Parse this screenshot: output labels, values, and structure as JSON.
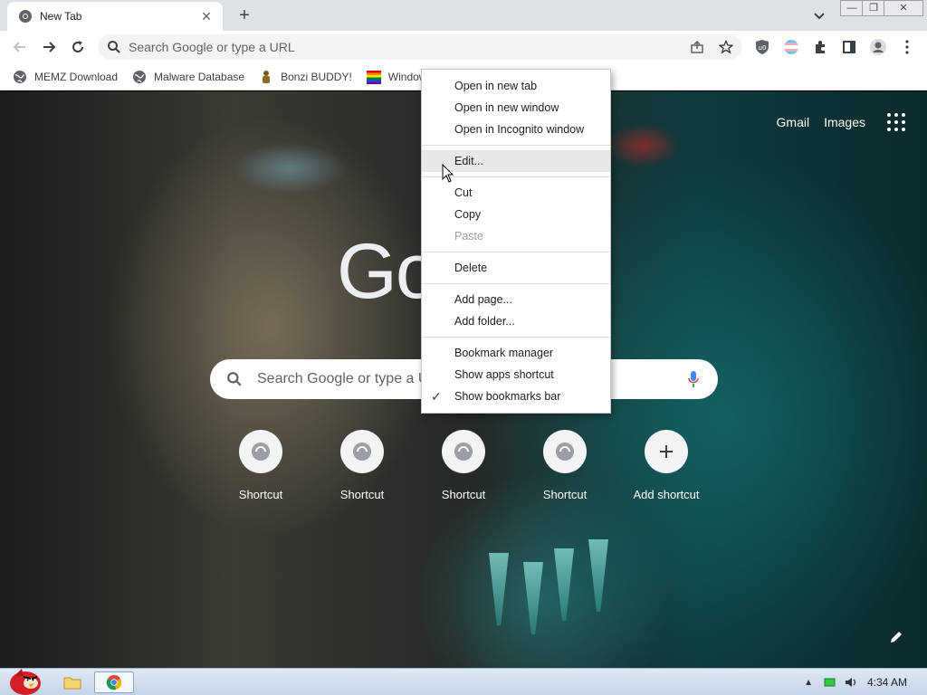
{
  "browser": {
    "tab": {
      "title": "New Tab"
    },
    "window_controls": [
      "minimize",
      "restore",
      "close"
    ]
  },
  "toolbar": {
    "omnibox_placeholder": "Search Google or type a URL"
  },
  "bookmarks": [
    {
      "label": "MEMZ Download",
      "icon": "globe-icon"
    },
    {
      "label": "Malware Database",
      "icon": "globe-icon"
    },
    {
      "label": "Bonzi BUDDY!",
      "icon": "bonzi-icon"
    },
    {
      "label": "Window",
      "icon": "windows-flag-icon"
    }
  ],
  "ntp": {
    "top_links": {
      "gmail": "Gmail",
      "images": "Images"
    },
    "logo_text": "Go",
    "search_placeholder": "Search Google or type a URL",
    "shortcuts": [
      {
        "label": "Shortcut",
        "icon": "shortcut-icon"
      },
      {
        "label": "Shortcut",
        "icon": "shortcut-icon"
      },
      {
        "label": "Shortcut",
        "icon": "shortcut-icon"
      },
      {
        "label": "Shortcut",
        "icon": "shortcut-icon"
      },
      {
        "label": "Add shortcut",
        "icon": "plus-icon"
      }
    ]
  },
  "context_menu": {
    "groups": [
      [
        "Open in new tab",
        "Open in new window",
        "Open in Incognito window"
      ],
      [
        "Edit..."
      ],
      [
        "Cut",
        "Copy",
        "Paste"
      ],
      [
        "Delete"
      ],
      [
        "Add page...",
        "Add folder..."
      ],
      [
        "Bookmark manager",
        "Show apps shortcut",
        "Show bookmarks bar"
      ]
    ],
    "items": {
      "open_new_tab": "Open in new tab",
      "open_new_window": "Open in new window",
      "open_incognito": "Open in Incognito window",
      "edit": "Edit...",
      "cut": "Cut",
      "copy": "Copy",
      "paste": "Paste",
      "delete": "Delete",
      "add_page": "Add page...",
      "add_folder": "Add folder...",
      "bookmark_manager": "Bookmark manager",
      "show_apps": "Show apps shortcut",
      "show_bookmarks_bar": "Show bookmarks bar"
    },
    "hovered_item": "Edit...",
    "disabled_items": [
      "Paste"
    ],
    "checked_items": [
      "Show bookmarks bar"
    ]
  },
  "taskbar": {
    "clock": "4:34 AM"
  },
  "colors": {
    "chrome_tabstrip": "#dee1e6",
    "omnibox_bg": "#f1f3f4",
    "menu_hover": "#e8e8e8",
    "google_blue": "#4285f4"
  }
}
